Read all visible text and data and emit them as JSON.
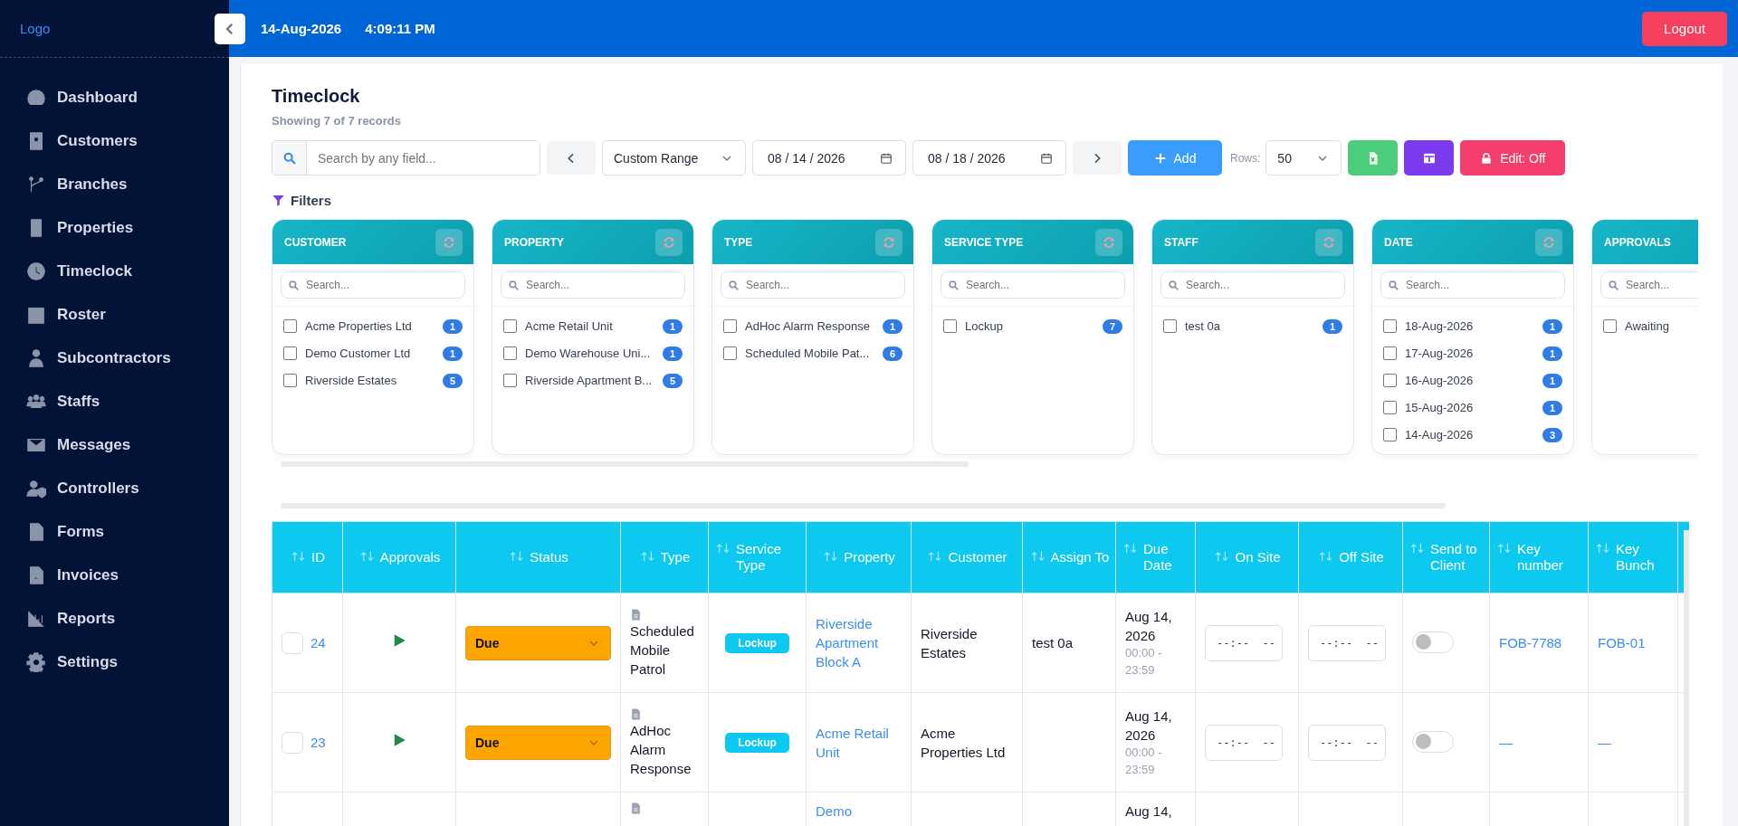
{
  "sidebar": {
    "logo": "Logo",
    "items": [
      {
        "label": "Dashboard"
      },
      {
        "label": "Customers"
      },
      {
        "label": "Branches"
      },
      {
        "label": "Properties"
      },
      {
        "label": "Timeclock"
      },
      {
        "label": "Roster"
      },
      {
        "label": "Subcontractors"
      },
      {
        "label": "Staffs"
      },
      {
        "label": "Messages"
      },
      {
        "label": "Controllers"
      },
      {
        "label": "Forms"
      },
      {
        "label": "Invoices"
      },
      {
        "label": "Reports"
      },
      {
        "label": "Settings"
      }
    ]
  },
  "topbar": {
    "date": "14-Aug-2026",
    "time": "4:09:11 PM",
    "logout": "Logout"
  },
  "page": {
    "title": "Timeclock",
    "subtitle": "Showing 7 of 7 records"
  },
  "toolbar": {
    "search_placeholder": "Search by any field...",
    "range": "Custom Range",
    "date_from": "08 / 14 / 2026",
    "date_to": "08 / 18 / 2026",
    "add": "Add",
    "rows_label": "Rows:",
    "rows": "50",
    "edit": "Edit: Off"
  },
  "filters": {
    "label": "Filters",
    "groups": [
      {
        "title": "CUSTOMER",
        "search_placeholder": "Search...",
        "options": [
          {
            "label": "Acme Properties Ltd",
            "count": "1",
            "checked": false
          },
          {
            "label": "Demo Customer Ltd",
            "count": "1",
            "checked": false
          },
          {
            "label": "Riverside Estates",
            "count": "5",
            "checked": false
          }
        ]
      },
      {
        "title": "PROPERTY",
        "search_placeholder": "Search...",
        "options": [
          {
            "label": "Acme Retail Unit",
            "count": "1",
            "checked": false
          },
          {
            "label": "Demo Warehouse Uni...",
            "count": "1",
            "checked": false
          },
          {
            "label": "Riverside Apartment B...",
            "count": "5",
            "checked": false
          }
        ]
      },
      {
        "title": "TYPE",
        "search_placeholder": "Search...",
        "options": [
          {
            "label": "AdHoc Alarm Response",
            "count": "1",
            "checked": false
          },
          {
            "label": "Scheduled Mobile Pat...",
            "count": "6",
            "checked": false
          }
        ]
      },
      {
        "title": "SERVICE TYPE",
        "search_placeholder": "Search...",
        "options": [
          {
            "label": "Lockup",
            "count": "7",
            "checked": false
          }
        ]
      },
      {
        "title": "STAFF",
        "search_placeholder": "Search...",
        "options": [
          {
            "label": "test 0a",
            "count": "1",
            "checked": false
          }
        ]
      },
      {
        "title": "DATE",
        "search_placeholder": "Search...",
        "options": [
          {
            "label": "18-Aug-2026",
            "count": "1",
            "checked": false
          },
          {
            "label": "17-Aug-2026",
            "count": "1",
            "checked": false
          },
          {
            "label": "16-Aug-2026",
            "count": "1",
            "checked": false
          },
          {
            "label": "15-Aug-2026",
            "count": "1",
            "checked": false
          },
          {
            "label": "14-Aug-2026",
            "count": "3",
            "checked": false
          }
        ]
      },
      {
        "title": "APPROVALS",
        "search_placeholder": "Search...",
        "options": [
          {
            "label": "Awaiting",
            "checked": false
          }
        ]
      }
    ]
  },
  "table": {
    "columns": [
      "ID",
      "Approvals",
      "Status",
      "Type",
      "Service Type",
      "Property",
      "Customer",
      "Assign To",
      "Due Date",
      "On Site",
      "Off Site",
      "Send to Client",
      "Key number",
      "Key Bunch"
    ],
    "rows": [
      {
        "checked": false,
        "id": "24",
        "status": "Due",
        "type": "Scheduled Mobile Patrol",
        "service_type": "Lockup",
        "property": "Riverside Apartment Block A",
        "customer": "Riverside Estates",
        "assign_to": "test 0a",
        "due_date": "Aug 14, 2026",
        "due_time": "00:00 - 23:59",
        "on_site": {
          "placeholder": "--:--  --"
        },
        "off_site": {
          "placeholder": "--:--  --"
        },
        "send_to_client": {
          "on": false
        },
        "key_number": "FOB-7788",
        "key_bunch": "FOB-01"
      },
      {
        "checked": false,
        "id": "23",
        "status": "Due",
        "type": "AdHoc Alarm Response",
        "service_type": "Lockup",
        "property": "Acme Retail Unit",
        "customer": "Acme Properties Ltd",
        "due_date": "Aug 14, 2026",
        "due_time": "00:00 - 23:59",
        "on_site": {
          "placeholder": "--:--  --"
        },
        "off_site": {
          "placeholder": "--:--  --"
        },
        "send_to_client": {
          "on": false
        },
        "key_number": "—",
        "key_bunch": "—"
      },
      {
        "property": "Demo",
        "due_date": "Aug 14,"
      }
    ]
  }
}
